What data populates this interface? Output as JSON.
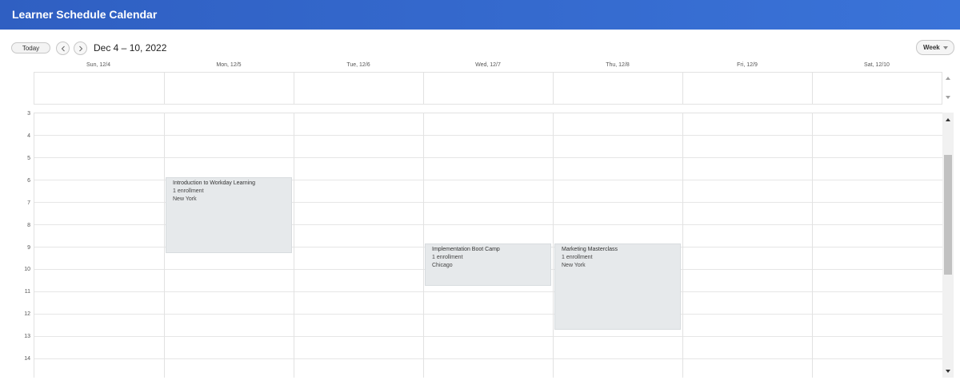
{
  "header": {
    "title": "Learner Schedule Calendar"
  },
  "toolbar": {
    "today_label": "Today",
    "date_range": "Dec 4 – 10, 2022",
    "view_label": "Week"
  },
  "days": [
    "Sun, 12/4",
    "Mon, 12/5",
    "Tue, 12/6",
    "Wed, 12/7",
    "Thu, 12/8",
    "Fri, 12/9",
    "Sat, 12/10"
  ],
  "hours": [
    "3",
    "4",
    "5",
    "6",
    "7",
    "8",
    "9",
    "10",
    "11",
    "12",
    "13",
    "14"
  ],
  "events": [
    {
      "title": "Introduction to Workday Learning",
      "enrollment": "1 enrollment",
      "location": "New York"
    },
    {
      "title": "Implementation Boot Camp",
      "enrollment": "1 enrollment",
      "location": "Chicago"
    },
    {
      "title": "Marketing Masterclass",
      "enrollment": "1 enrollment",
      "location": "New York"
    }
  ],
  "colors": {
    "header_start": "#2f5fc2",
    "header_end": "#3a73d8",
    "event_bg": "#e6e9eb"
  }
}
